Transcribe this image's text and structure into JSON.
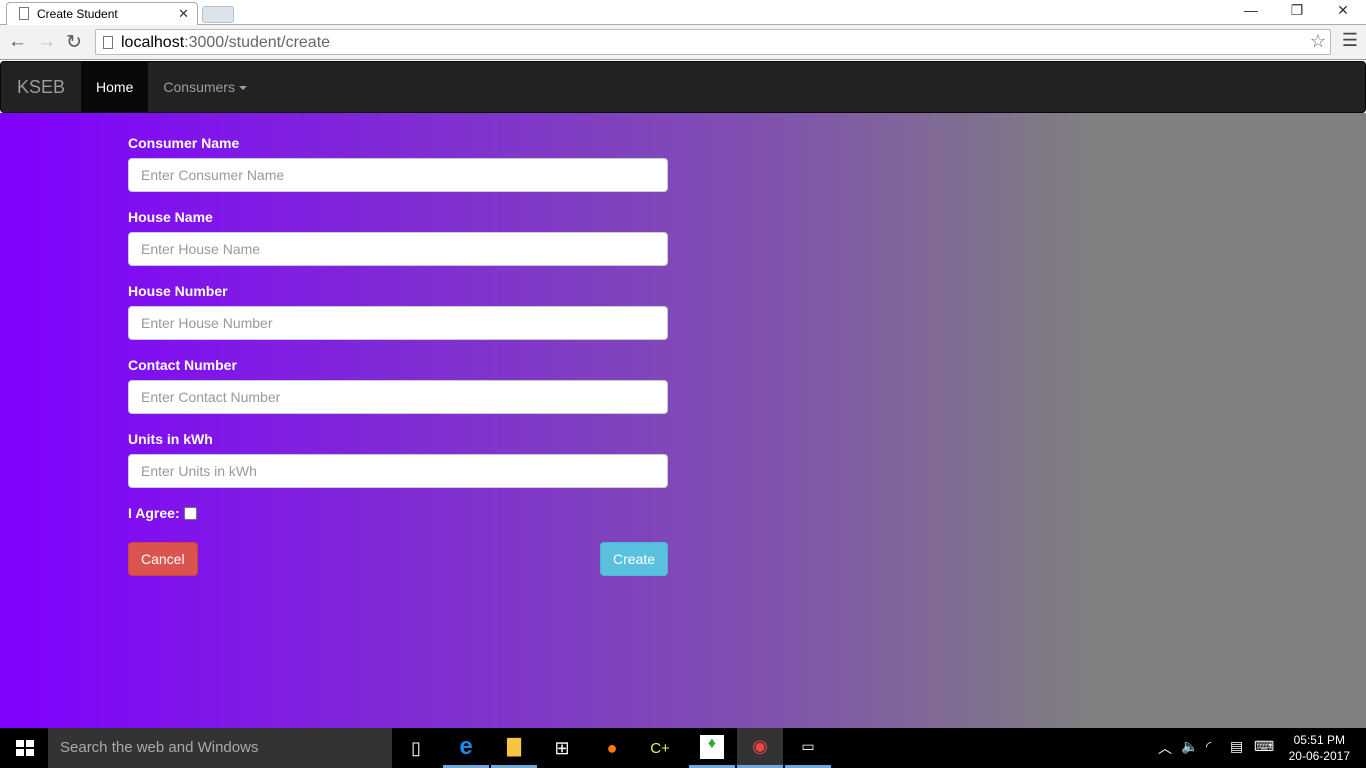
{
  "browser": {
    "tab_title": "Create Student",
    "url_host": "localhost",
    "url_path": ":3000/student/create"
  },
  "navbar": {
    "brand": "KSEB",
    "items": [
      {
        "label": "Home",
        "active": true
      },
      {
        "label": "Consumers",
        "dropdown": true
      }
    ]
  },
  "form": {
    "fields": [
      {
        "label": "Consumer Name",
        "placeholder": "Enter Consumer Name",
        "value": ""
      },
      {
        "label": "House Name",
        "placeholder": "Enter House Name",
        "value": ""
      },
      {
        "label": "House Number",
        "placeholder": "Enter House Number",
        "value": ""
      },
      {
        "label": "Contact Number",
        "placeholder": "Enter Contact Number",
        "value": ""
      },
      {
        "label": "Units in kWh",
        "placeholder": "Enter Units in kWh",
        "value": ""
      }
    ],
    "agree_label": "I Agree:",
    "agree_checked": false,
    "cancel_label": "Cancel",
    "create_label": "Create"
  },
  "colors": {
    "gradient_start": "#8000ff",
    "gradient_end": "#808080",
    "cancel": "#d9534f",
    "create": "#5bc0de",
    "navbar": "#222222"
  },
  "taskbar": {
    "search_placeholder": "Search the web and Windows",
    "time": "05:51 PM",
    "date": "20-06-2017",
    "apps": [
      "task-view",
      "edge",
      "file-explorer",
      "store",
      "firefox",
      "cpp-ide",
      "mongodb",
      "chrome",
      "command-prompt"
    ]
  }
}
